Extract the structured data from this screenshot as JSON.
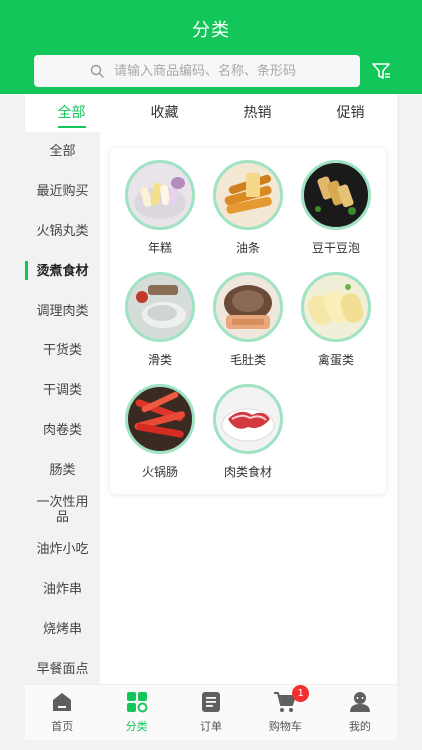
{
  "header": {
    "title": "分类"
  },
  "search": {
    "placeholder": "请输入商品编码、名称、条形码"
  },
  "colors": {
    "brand": "#13c65a",
    "badge": "#f23030"
  },
  "tabs": [
    {
      "label": "全部",
      "active": true
    },
    {
      "label": "收藏",
      "active": false
    },
    {
      "label": "热销",
      "active": false
    },
    {
      "label": "促销",
      "active": false
    }
  ],
  "sidebar": {
    "items": [
      {
        "label": "全部"
      },
      {
        "label": "最近购买"
      },
      {
        "label": "火锅丸类"
      },
      {
        "label": "烫煮食材",
        "active": true
      },
      {
        "label": "调理肉类"
      },
      {
        "label": "干货类"
      },
      {
        "label": "干调类"
      },
      {
        "label": "肉卷类"
      },
      {
        "label": "肠类"
      },
      {
        "label": "一次性用品"
      },
      {
        "label": "油炸小吃"
      },
      {
        "label": "油炸串"
      },
      {
        "label": "烧烤串"
      },
      {
        "label": "早餐面点"
      }
    ]
  },
  "categories": [
    {
      "label": "年糕",
      "icon": "rice-cake-photo"
    },
    {
      "label": "油条",
      "icon": "fried-dough-photo"
    },
    {
      "label": "豆干豆泡",
      "icon": "tofu-puff-photo"
    },
    {
      "label": "滑类",
      "icon": "paste-photo"
    },
    {
      "label": "毛肚类",
      "icon": "tripe-photo"
    },
    {
      "label": "禽蛋类",
      "icon": "egg-photo"
    },
    {
      "label": "火锅肠",
      "icon": "sausage-photo"
    },
    {
      "label": "肉类食材",
      "icon": "meat-photo"
    }
  ],
  "tabbar": {
    "items": [
      {
        "label": "首页",
        "icon": "home-icon"
      },
      {
        "label": "分类",
        "icon": "category-icon",
        "active": true
      },
      {
        "label": "订单",
        "icon": "order-icon"
      },
      {
        "label": "购物车",
        "icon": "cart-icon",
        "badge": "1"
      },
      {
        "label": "我的",
        "icon": "user-icon"
      }
    ]
  }
}
